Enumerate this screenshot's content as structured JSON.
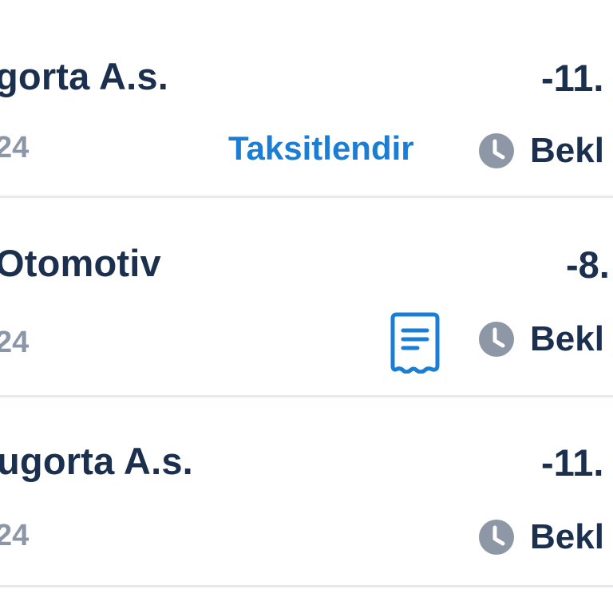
{
  "transactions": [
    {
      "merchant": "gorta A.s.",
      "amount": "-11.",
      "date": "24",
      "action_label": "Taksitlendir",
      "status": "Bekl"
    },
    {
      "merchant": " Otomotiv",
      "amount": "-8.",
      "date": "24",
      "action_icon": "receipt-icon",
      "status": "Bekl"
    },
    {
      "merchant": "ugorta A.s.",
      "amount": "-11.",
      "date": "24",
      "status": "Bekl"
    }
  ],
  "icons": {
    "status": "clock-icon",
    "receipt": "receipt-icon"
  },
  "colors": {
    "text_primary": "#1b2f4e",
    "text_secondary": "#8b97a6",
    "accent": "#1a7fd4",
    "icon_muted": "#8d97a5",
    "divider": "#e6e9ed"
  }
}
